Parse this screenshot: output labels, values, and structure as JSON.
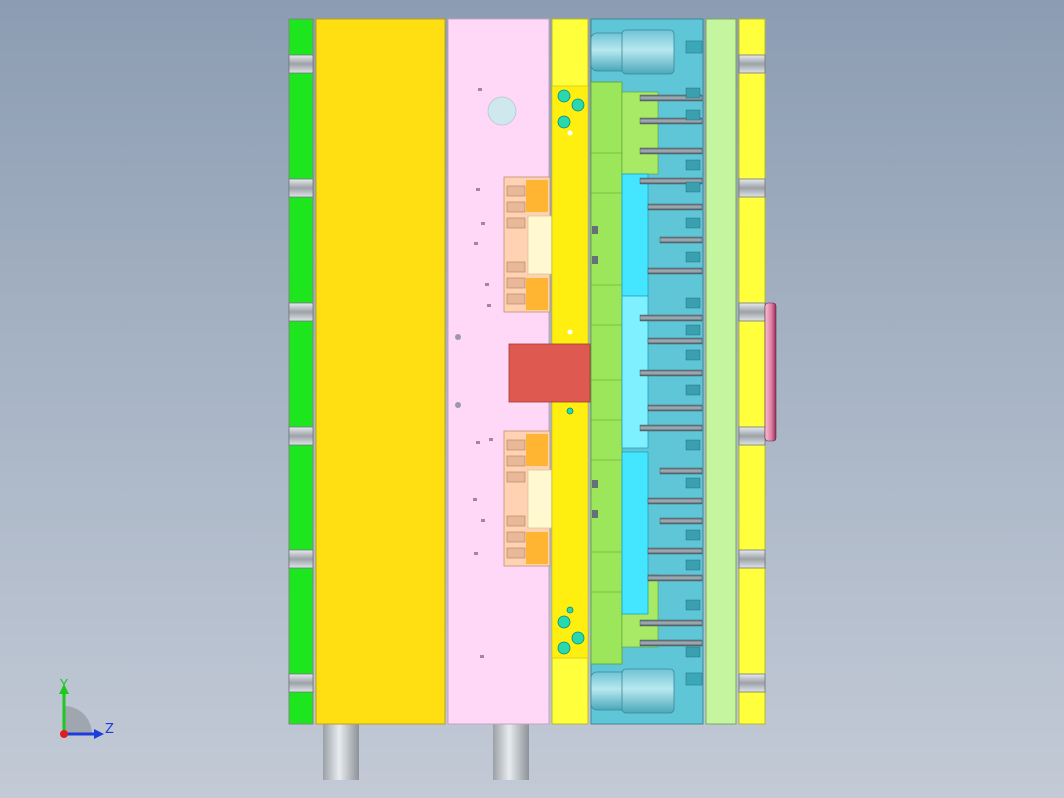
{
  "viewport": {
    "background_top": "#8c9cb2",
    "background_bottom": "#c3cad6"
  },
  "colors": {
    "clamp_plate_green": "#1ee61e",
    "cavity_plate_yellow": "#ffdf12",
    "stripper_plate_pink": "#ffd7f7",
    "bright_yellow": "#ffff3c",
    "core_green": "#9be65a",
    "support_blue": "#5fc6d8",
    "ejector_plate_green": "#c6f5a0",
    "cyan_block": "#44e6ff",
    "insert_orange": "#ffb432",
    "insert_salmon": "#ffd2b4",
    "insert_cream": "#fff8d0",
    "sprue_red": "#de5a50",
    "pillar_grey": "#d2d6da",
    "disk_pink": "#e8a0b8"
  },
  "triad": {
    "y_label": "Y",
    "z_label": "Z",
    "y_color": "#1ec81e",
    "z_color": "#1e3cdc",
    "x_color": "#dc1e1e"
  }
}
